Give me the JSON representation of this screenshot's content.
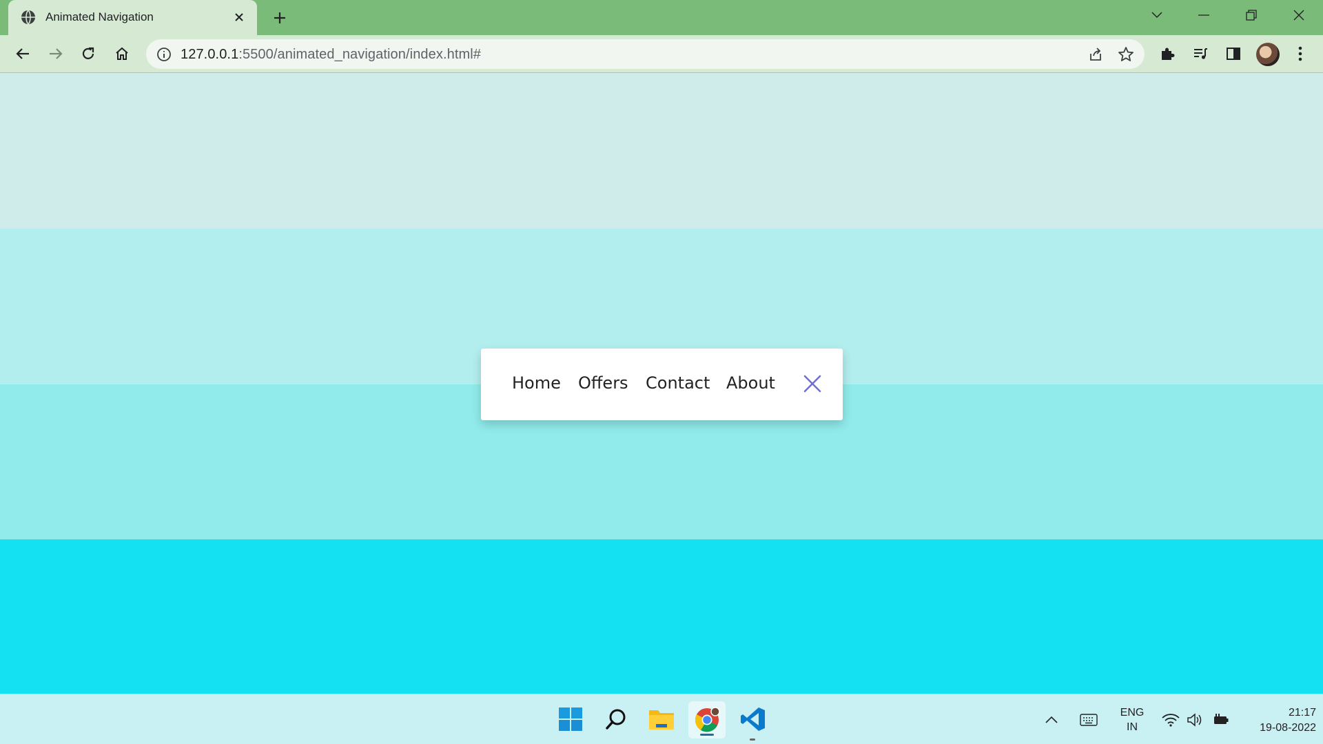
{
  "browser": {
    "tab_title": "Animated Navigation",
    "url_host": "127.0.0.1",
    "url_path": ":5500/animated_navigation/index.html#"
  },
  "nav": {
    "items": [
      "Home",
      "Offers",
      "Contact",
      "About"
    ]
  },
  "taskbar": {
    "lang_primary": "ENG",
    "lang_secondary": "IN",
    "time": "21:17",
    "date": "19-08-2022"
  },
  "colors": {
    "tab_bar": "#7bbb7a",
    "toolbar": "#d6ead3",
    "band_1": "#cfebea",
    "band_2": "#b2eeee",
    "band_3": "#90ebea",
    "band_4": "#14e2f2",
    "close_icon": "#6f6fd8"
  },
  "icons": [
    "globe-icon",
    "close-tab-icon",
    "plus-icon",
    "chevron-down-icon",
    "minimize-icon",
    "restore-icon",
    "close-window-icon",
    "back-arrow-icon",
    "forward-arrow-icon",
    "reload-icon",
    "home-icon",
    "info-icon",
    "share-icon",
    "star-icon",
    "extensions-icon",
    "media-icon",
    "side-panel-icon",
    "menu-dots-icon",
    "nav-close-icon",
    "windows-start-icon",
    "search-icon",
    "file-explorer-icon",
    "chrome-icon",
    "vscode-icon",
    "chevron-up-icon",
    "keyboard-icon",
    "wifi-icon",
    "volume-icon",
    "battery-icon"
  ]
}
